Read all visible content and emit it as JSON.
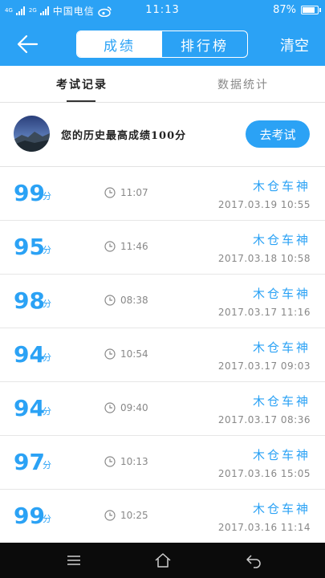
{
  "status_bar": {
    "signal_text": [
      "4G",
      "2G"
    ],
    "carrier": "中国电信",
    "time": "11:13",
    "battery": "87%",
    "battery_level": 0.87
  },
  "header": {
    "tabs": [
      "成绩",
      "排行榜"
    ],
    "clear_label": "清空"
  },
  "subtabs": [
    "考试记录",
    "数据统计"
  ],
  "best": {
    "text": "您的历史最高成绩100分",
    "button_label": "去考试"
  },
  "records": [
    {
      "score": "99",
      "unit": "分",
      "duration": "11:07",
      "user": "木仓车神",
      "date": "2017.03.19  10:55"
    },
    {
      "score": "95",
      "unit": "分",
      "duration": "11:46",
      "user": "木仓车神",
      "date": "2017.03.18  10:58"
    },
    {
      "score": "98",
      "unit": "分",
      "duration": "08:38",
      "user": "木仓车神",
      "date": "2017.03.17  11:16"
    },
    {
      "score": "94",
      "unit": "分",
      "duration": "10:54",
      "user": "木仓车神",
      "date": "2017.03.17  09:03"
    },
    {
      "score": "94",
      "unit": "分",
      "duration": "09:40",
      "user": "木仓车神",
      "date": "2017.03.17  08:36"
    },
    {
      "score": "97",
      "unit": "分",
      "duration": "10:13",
      "user": "木仓车神",
      "date": "2017.03.16  15:05"
    },
    {
      "score": "99",
      "unit": "分",
      "duration": "10:25",
      "user": "木仓车神",
      "date": "2017.03.16  11:14"
    }
  ],
  "colors": {
    "accent": "#2ba2f5",
    "nav_bg": "#0b0b0b"
  },
  "icons": {
    "back": "arrow-left-icon",
    "clock": "clock-icon",
    "nav": [
      "menu-icon",
      "home-icon",
      "back-icon"
    ]
  }
}
